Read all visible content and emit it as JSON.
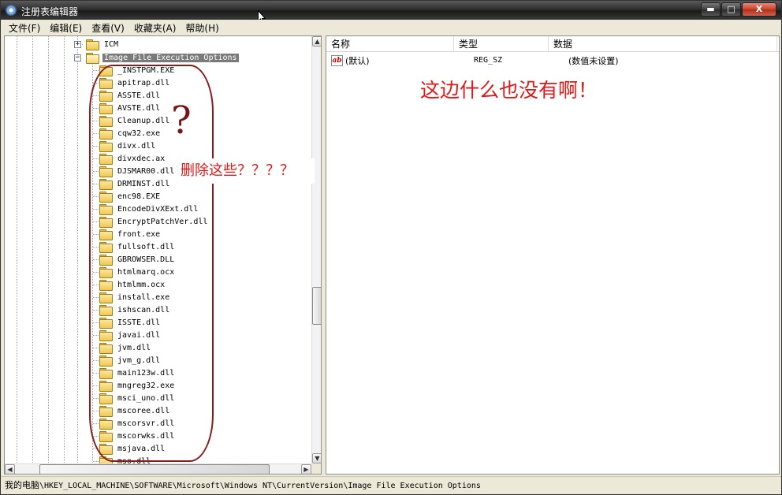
{
  "window": {
    "title": "注册表编辑器",
    "buttons": {
      "minimize": "▬",
      "maximize": "□",
      "close": "X"
    }
  },
  "menu": [
    "文件(F)",
    "编辑(E)",
    "查看(V)",
    "收藏夹(A)",
    "帮助(H)"
  ],
  "tree": {
    "parent_nodes": [
      {
        "label": "ICM",
        "expander": "+"
      },
      {
        "label": "Image File Execution Options",
        "expander": "−",
        "selected": true
      }
    ],
    "children": [
      "_INSTPGM.EXE",
      "apitrap.dll",
      "ASSTE.dll",
      "AVSTE.dll",
      "Cleanup.dll",
      "cqw32.exe",
      "divx.dll",
      "divxdec.ax",
      "DJSMAR00.dll",
      "DRMINST.dll",
      "enc98.EXE",
      "EncodeDivXExt.dll",
      "EncryptPatchVer.dll",
      "front.exe",
      "fullsoft.dll",
      "GBROWSER.DLL",
      "htmlmarq.ocx",
      "htmlmm.ocx",
      "install.exe",
      "ishscan.dll",
      "ISSTE.dll",
      "javai.dll",
      "jvm.dll",
      "jvm_g.dll",
      "main123w.dll",
      "mngreg32.exe",
      "msci_uno.dll",
      "mscoree.dll",
      "mscorsvr.dll",
      "mscorwks.dll",
      "msjava.dll",
      "mso.dll"
    ]
  },
  "list": {
    "columns": [
      "名称",
      "类型",
      "数据"
    ],
    "rows": [
      {
        "icon": "ab",
        "name": "(默认)",
        "type": "REG_SZ",
        "data": "(数值未设置)"
      }
    ]
  },
  "annotations": {
    "question_mark": "?",
    "delete_text": "删除这些？？？？",
    "nothing_text": "这边什么也没有啊！",
    "color": "#e01818"
  },
  "scrollbar": {
    "up": "▲",
    "down": "▼",
    "left": "◀",
    "right": "▶"
  },
  "statusbar": {
    "computer": "我的电脑",
    "path": "\\HKEY_LOCAL_MACHINE\\SOFTWARE\\Microsoft\\Windows NT\\CurrentVersion\\Image File Execution Options"
  }
}
